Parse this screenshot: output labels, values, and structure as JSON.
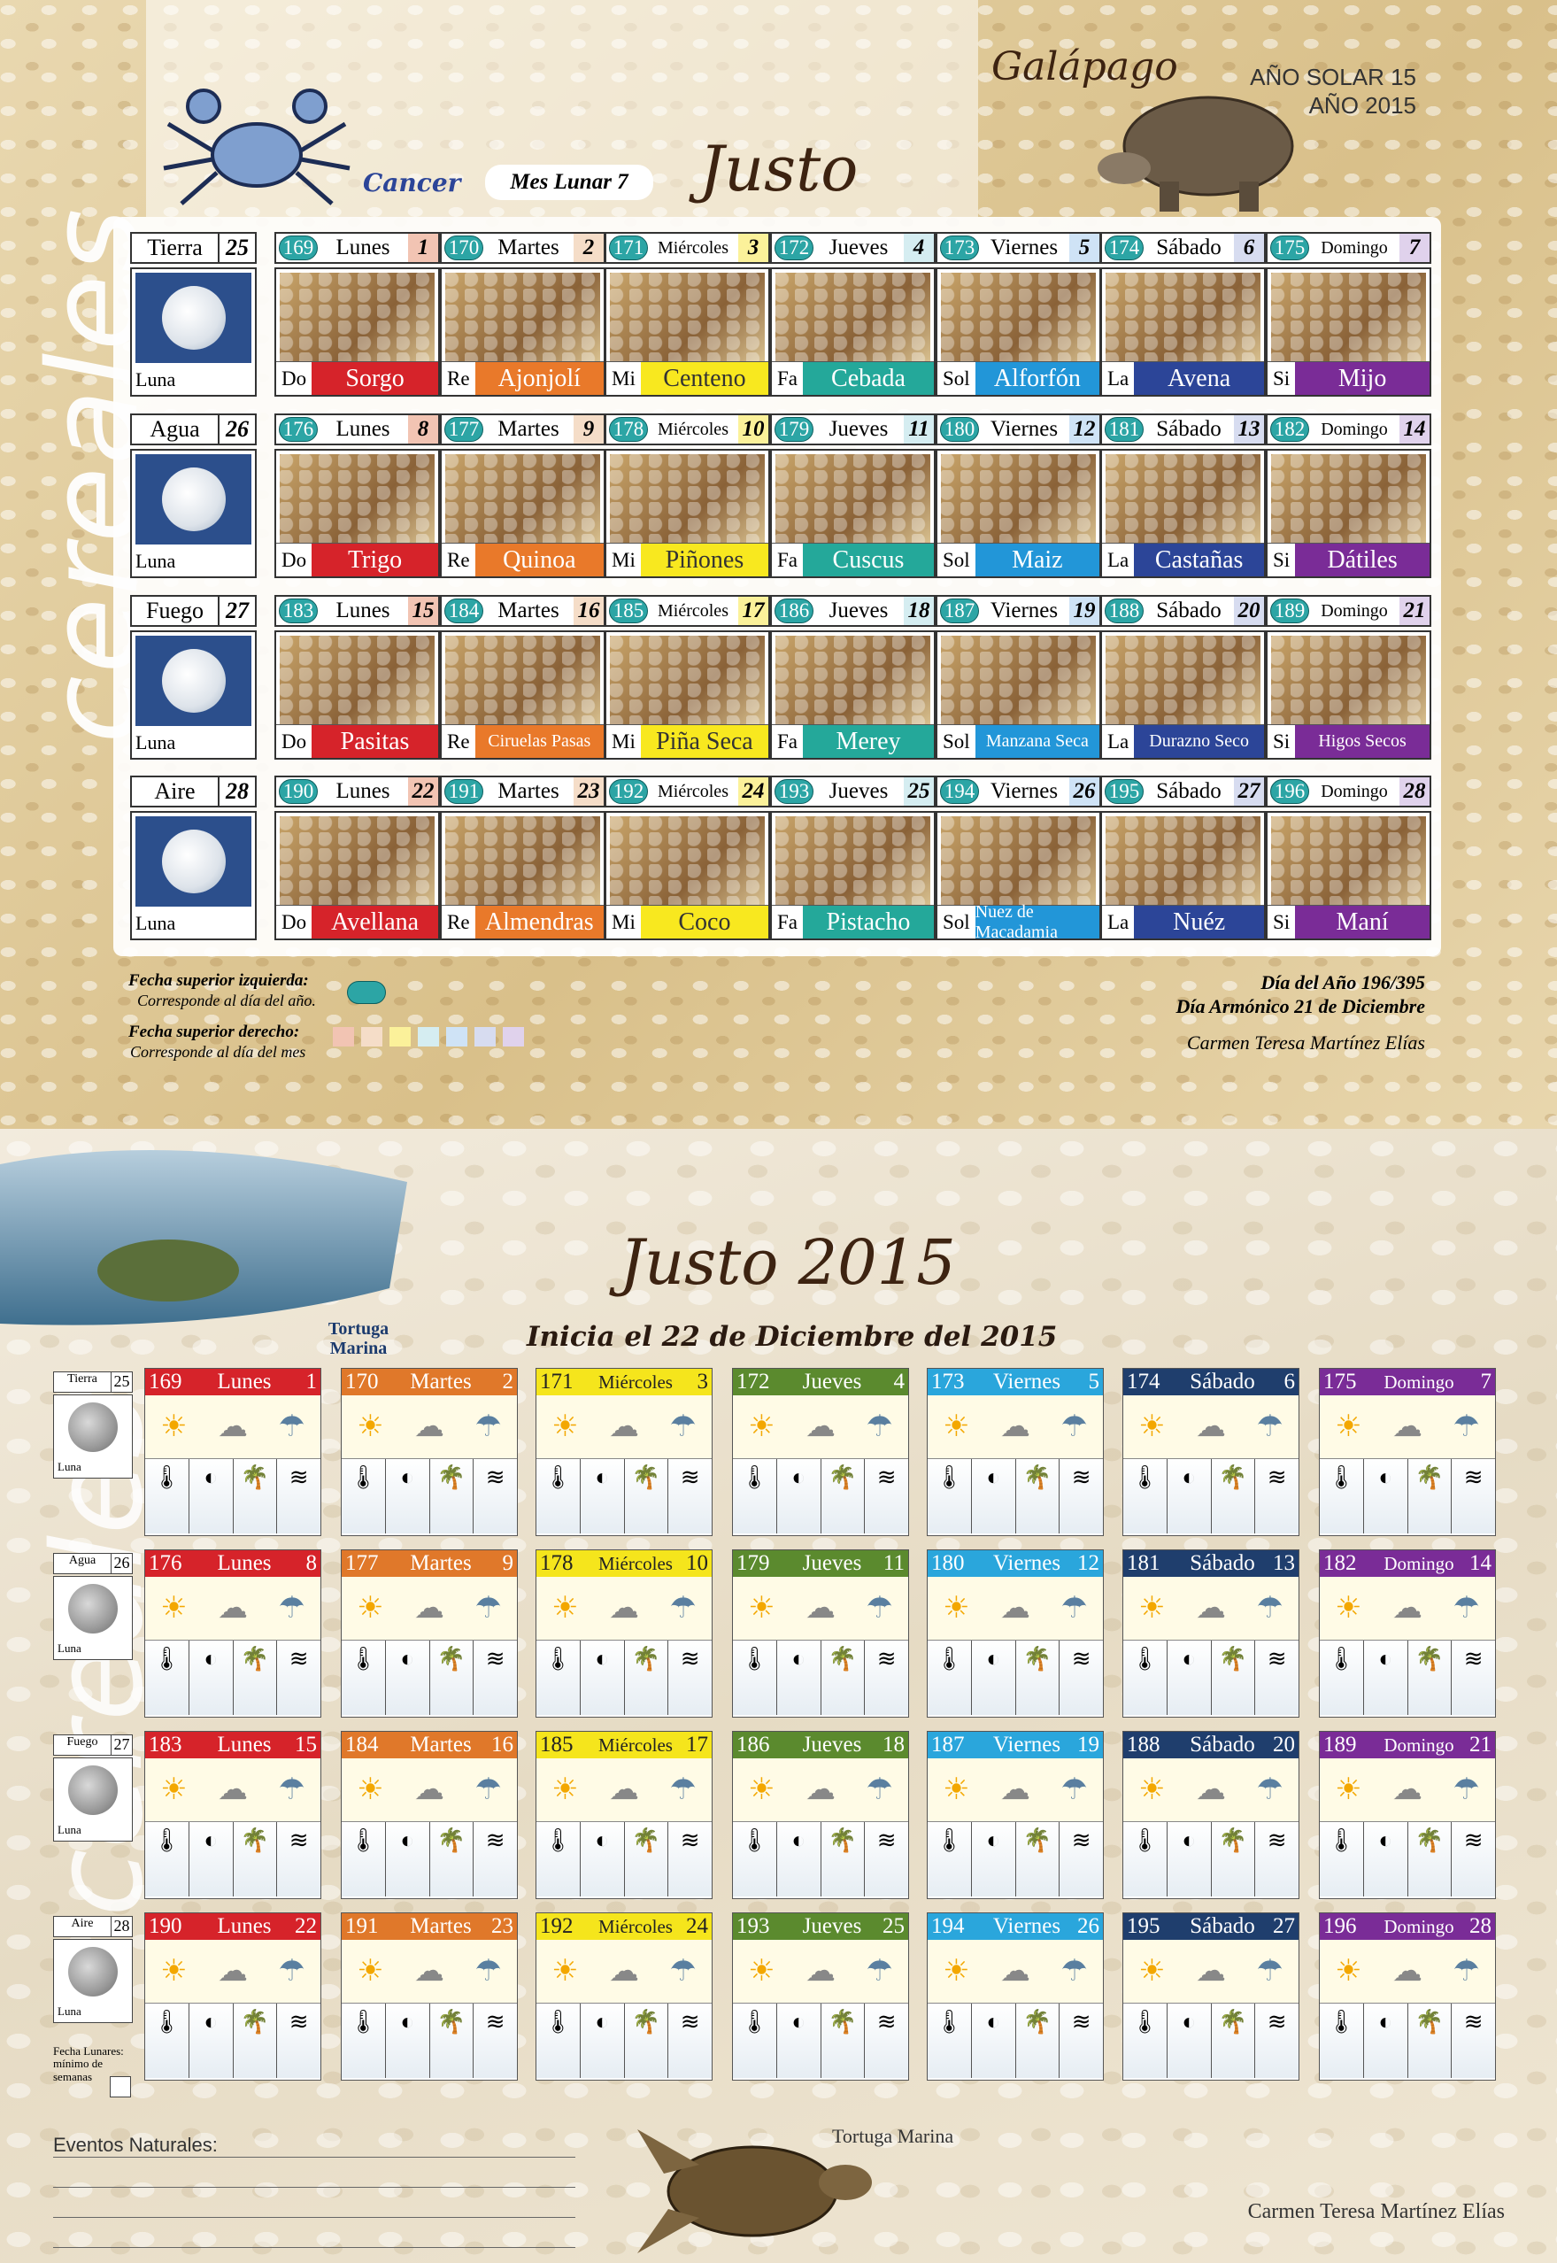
{
  "header": {
    "sign": "Cancer",
    "lunar_month": "Mes Lunar 7",
    "month_name": "Justo",
    "animal": "Galápago",
    "solar_year": "AÑO SOLAR 15",
    "year": "AÑO 2015",
    "vertical_word": "cereales"
  },
  "weeks": [
    {
      "element": "Tierra",
      "num": "25",
      "moon": "Luna",
      "days": [
        {
          "yd": "169",
          "name": "Lunes",
          "md": "1",
          "color": "#f2c4b3",
          "abbr": "Do",
          "food": "Sorgo",
          "fcolor": "#d6232a"
        },
        {
          "yd": "170",
          "name": "Martes",
          "md": "2",
          "color": "#f5ddc8",
          "abbr": "Re",
          "food": "Ajonjolí",
          "fcolor": "#e9792a"
        },
        {
          "yd": "171",
          "name": "Miércoles",
          "md": "3",
          "color": "#fbf19a",
          "abbr": "Mi",
          "food": "Centeno",
          "fcolor": "#f8e81f"
        },
        {
          "yd": "172",
          "name": "Jueves",
          "md": "4",
          "color": "#d5edf1",
          "abbr": "Fa",
          "food": "Cebada",
          "fcolor": "#24a89a"
        },
        {
          "yd": "173",
          "name": "Viernes",
          "md": "5",
          "color": "#cfe3f6",
          "abbr": "Sol",
          "food": "Alforfón",
          "fcolor": "#2296d8"
        },
        {
          "yd": "174",
          "name": "Sábado",
          "md": "6",
          "color": "#d7dcf0",
          "abbr": "La",
          "food": "Avena",
          "fcolor": "#2c4598"
        },
        {
          "yd": "175",
          "name": "Domingo",
          "md": "7",
          "color": "#e0d2ec",
          "abbr": "Si",
          "food": "Mijo",
          "fcolor": "#7a2c97"
        }
      ]
    },
    {
      "element": "Agua",
      "num": "26",
      "moon": "Luna",
      "days": [
        {
          "yd": "176",
          "name": "Lunes",
          "md": "8",
          "color": "#f2c4b3",
          "abbr": "Do",
          "food": "Trigo",
          "fcolor": "#d6232a"
        },
        {
          "yd": "177",
          "name": "Martes",
          "md": "9",
          "color": "#f5ddc8",
          "abbr": "Re",
          "food": "Quinoa",
          "fcolor": "#e9792a"
        },
        {
          "yd": "178",
          "name": "Miércoles",
          "md": "10",
          "color": "#fbf19a",
          "abbr": "Mi",
          "food": "Piñones",
          "fcolor": "#f8e81f"
        },
        {
          "yd": "179",
          "name": "Jueves",
          "md": "11",
          "color": "#d5edf1",
          "abbr": "Fa",
          "food": "Cuscus",
          "fcolor": "#24a89a"
        },
        {
          "yd": "180",
          "name": "Viernes",
          "md": "12",
          "color": "#cfe3f6",
          "abbr": "Sol",
          "food": "Maiz",
          "fcolor": "#2296d8"
        },
        {
          "yd": "181",
          "name": "Sábado",
          "md": "13",
          "color": "#d7dcf0",
          "abbr": "La",
          "food": "Castañas",
          "fcolor": "#2c4598"
        },
        {
          "yd": "182",
          "name": "Domingo",
          "md": "14",
          "color": "#e0d2ec",
          "abbr": "Si",
          "food": "Dátiles",
          "fcolor": "#7a2c97"
        }
      ]
    },
    {
      "element": "Fuego",
      "num": "27",
      "moon": "Luna",
      "days": [
        {
          "yd": "183",
          "name": "Lunes",
          "md": "15",
          "color": "#f2c4b3",
          "abbr": "Do",
          "food": "Pasitas",
          "fcolor": "#d6232a"
        },
        {
          "yd": "184",
          "name": "Martes",
          "md": "16",
          "color": "#f5ddc8",
          "abbr": "Re",
          "food": "Ciruelas Pasas",
          "fcolor": "#e9792a"
        },
        {
          "yd": "185",
          "name": "Miércoles",
          "md": "17",
          "color": "#fbf19a",
          "abbr": "Mi",
          "food": "Piña Seca",
          "fcolor": "#f8e81f"
        },
        {
          "yd": "186",
          "name": "Jueves",
          "md": "18",
          "color": "#d5edf1",
          "abbr": "Fa",
          "food": "Merey",
          "fcolor": "#24a89a"
        },
        {
          "yd": "187",
          "name": "Viernes",
          "md": "19",
          "color": "#cfe3f6",
          "abbr": "Sol",
          "food": "Manzana Seca",
          "fcolor": "#2296d8"
        },
        {
          "yd": "188",
          "name": "Sábado",
          "md": "20",
          "color": "#d7dcf0",
          "abbr": "La",
          "food": "Durazno Seco",
          "fcolor": "#2c4598"
        },
        {
          "yd": "189",
          "name": "Domingo",
          "md": "21",
          "color": "#e0d2ec",
          "abbr": "Si",
          "food": "Higos Secos",
          "fcolor": "#7a2c97"
        }
      ]
    },
    {
      "element": "Aire",
      "num": "28",
      "moon": "Luna",
      "days": [
        {
          "yd": "190",
          "name": "Lunes",
          "md": "22",
          "color": "#f2c4b3",
          "abbr": "Do",
          "food": "Avellana",
          "fcolor": "#d6232a"
        },
        {
          "yd": "191",
          "name": "Martes",
          "md": "23",
          "color": "#f5ddc8",
          "abbr": "Re",
          "food": "Almendras",
          "fcolor": "#e9792a"
        },
        {
          "yd": "192",
          "name": "Miércoles",
          "md": "24",
          "color": "#fbf19a",
          "abbr": "Mi",
          "food": "Coco",
          "fcolor": "#f8e81f"
        },
        {
          "yd": "193",
          "name": "Jueves",
          "md": "25",
          "color": "#d5edf1",
          "abbr": "Fa",
          "food": "Pistacho",
          "fcolor": "#24a89a"
        },
        {
          "yd": "194",
          "name": "Viernes",
          "md": "26",
          "color": "#cfe3f6",
          "abbr": "Sol",
          "food": "Nuez de Macadamia",
          "fcolor": "#2296d8"
        },
        {
          "yd": "195",
          "name": "Sábado",
          "md": "27",
          "color": "#d7dcf0",
          "abbr": "La",
          "food": "Nuéz",
          "fcolor": "#2c4598"
        },
        {
          "yd": "196",
          "name": "Domingo",
          "md": "28",
          "color": "#e0d2ec",
          "abbr": "Si",
          "food": "Maní",
          "fcolor": "#7a2c97"
        }
      ]
    }
  ],
  "legend": {
    "top_left_title": "Fecha superior izquierda:",
    "top_left_desc": "Corresponde al día del año.",
    "top_right_title": "Fecha superior derecho:",
    "top_right_desc": "Corresponde al día del mes"
  },
  "info": {
    "day_of_year": "Día del Año 196/395",
    "harmonic": "Día Armónico 21 de Diciembre",
    "author": "Carmen Teresa Martínez Elías"
  },
  "lower": {
    "title": "Justo 2015",
    "subtitle": "Inicia el 22 de Diciembre del 2015",
    "animal": "Tortuga Marina",
    "animal_top": "Tortuga Marina",
    "moon_note": "Fecha Lunares: mínimo de semanas",
    "events_label": "Eventos Naturales:",
    "author": "Carmen Teresa Martínez Elías",
    "header_colors": [
      "#d6232a",
      "#e0782a",
      "#f5e51c",
      "#5b8a2e",
      "#2aa6dc",
      "#1f3e6d",
      "#7a2c97"
    ]
  }
}
